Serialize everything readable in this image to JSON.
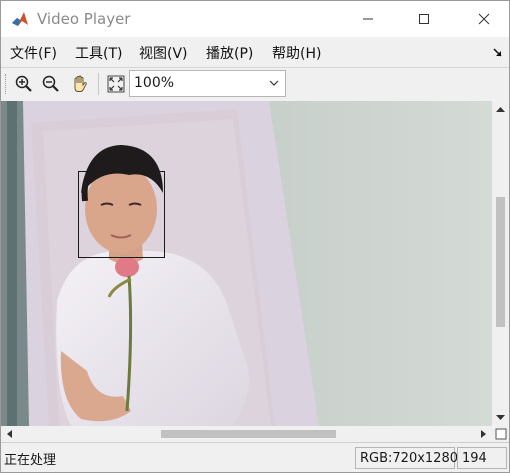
{
  "window": {
    "title": "Video Player"
  },
  "menu": {
    "items": [
      {
        "label": "文件(F)"
      },
      {
        "label": "工具(T)"
      },
      {
        "label": "视图(V)"
      },
      {
        "label": "播放(P)"
      },
      {
        "label": "帮助(H)"
      }
    ]
  },
  "toolbar": {
    "zoom_in_icon": "zoom-in-icon",
    "zoom_out_icon": "zoom-out-icon",
    "pan_icon": "hand-pan-icon",
    "fit_icon": "fit-to-window-icon",
    "zoom_value": "100%"
  },
  "status": {
    "state": "正在处理",
    "resolution": "RGB:720x1280",
    "frame": "194"
  },
  "colors": {
    "face_box": "#1a1a1a",
    "background_wall": "#c9d0cb",
    "photo_frame": "#e6dfe7"
  }
}
